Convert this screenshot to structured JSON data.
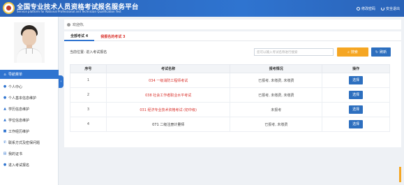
{
  "header": {
    "title": "全国专业技术人员资格考试报名服务平台",
    "subtitle": "Service platform for National Professional and Technician Qualification Test",
    "links": [
      {
        "label": "修改密码",
        "icon": "gear-icon"
      },
      {
        "label": "安全退出",
        "icon": "power-icon"
      }
    ]
  },
  "sidebar": {
    "menu": [
      {
        "label": "导航菜单",
        "icon": "home-icon",
        "active": true
      },
      {
        "label": "个人中心",
        "icon": "person-icon"
      },
      {
        "label": "个人基本信息维护",
        "icon": "person-icon"
      },
      {
        "label": "学历信息维护",
        "icon": "graduation-cap-icon"
      },
      {
        "label": "学位信息维护",
        "icon": "graduation-cap-icon"
      },
      {
        "label": "工作经历维护",
        "icon": "briefcase-icon"
      },
      {
        "label": "联系方式及密保问题",
        "icon": "phone-icon"
      },
      {
        "label": "我的证书",
        "icon": "book-icon"
      },
      {
        "label": "进入考试报名",
        "icon": "person-icon"
      }
    ]
  },
  "welcome": {
    "label": "欢迎你,"
  },
  "tabs": [
    {
      "label": "全部考试 4",
      "active": true
    },
    {
      "label": "我报名的考试 3",
      "active": false
    }
  ],
  "breadcrumb": "当前位置: 进入考试报名",
  "search": {
    "placeholder": "您可以输入考试名称进行搜索",
    "button": "搜索",
    "refresh": "刷新"
  },
  "table": {
    "headers": [
      "序号",
      "考试名称",
      "报考情况",
      "操作"
    ],
    "rows": [
      {
        "no": "1",
        "name": "034 一级消防工程师考试",
        "status": "已报考, 未缴费, 未缴费",
        "action": "选择",
        "highlight": true
      },
      {
        "no": "2",
        "name": "038 社会工作者职业水平考试",
        "status": "已报考, 未缴费, 未缴费",
        "action": "选择",
        "highlight": true
      },
      {
        "no": "3",
        "name": "031 经济专业技术资格考试 (初中级)",
        "status": "未报考",
        "action": "选择",
        "highlight": true
      },
      {
        "no": "4",
        "name": "071 二级注册计量师",
        "status": "已报考, 未缴费",
        "action": "选择",
        "highlight": false
      }
    ]
  },
  "colors": {
    "brand": "#2f74d0",
    "accent": "#f5a623",
    "alert": "#d9312b"
  }
}
